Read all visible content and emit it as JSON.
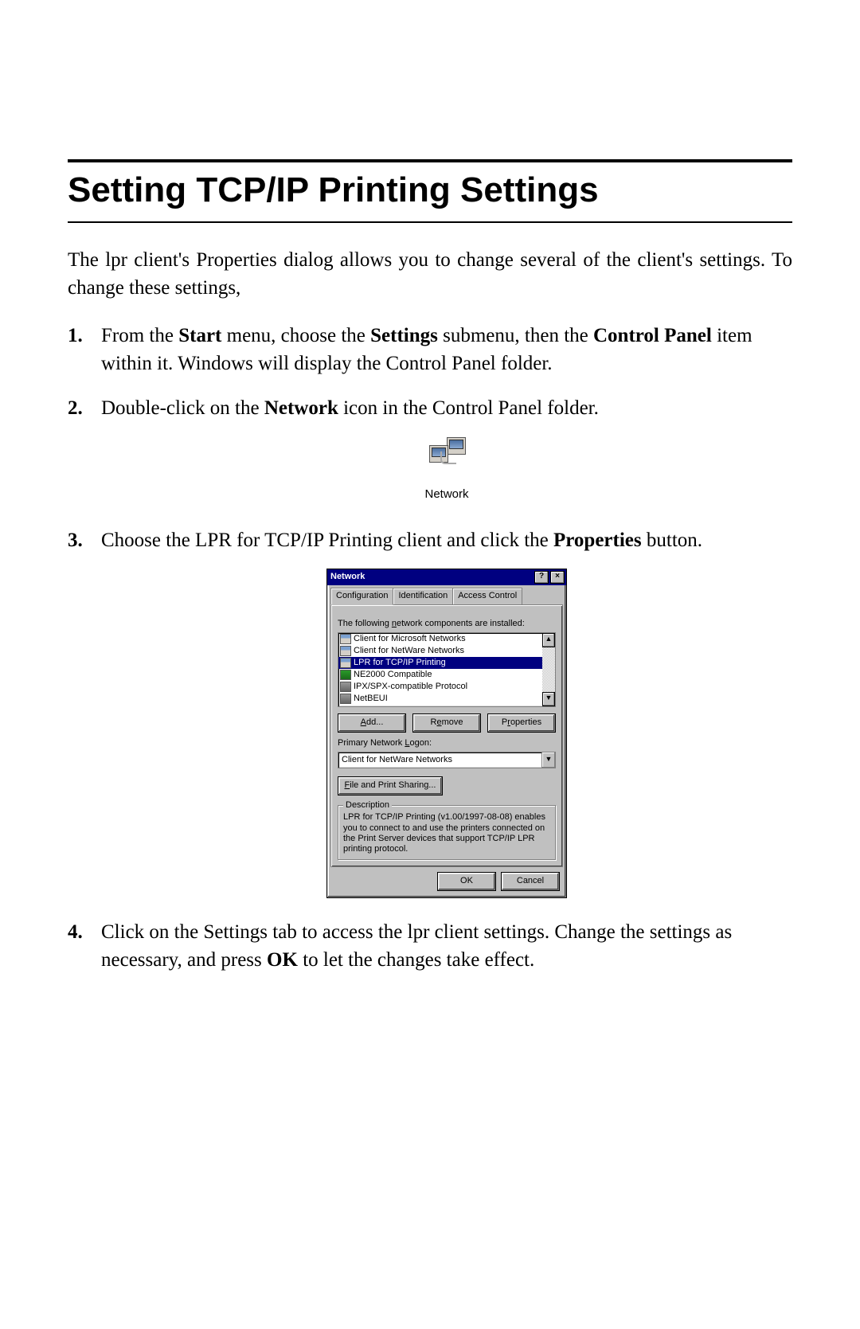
{
  "title": "Setting TCP/IP Printing Settings",
  "intro": "The lpr client's Properties dialog allows you to change several of the client's settings.    To change these settings,",
  "steps": {
    "s1": {
      "pre": "From the ",
      "b1": "Start",
      "mid1": " menu, choose the ",
      "b2": "Settings",
      "mid2": " submenu, then the ",
      "b3": "Control Panel",
      "mid3": " item within it.    Windows will display the Control Panel folder."
    },
    "s2": {
      "pre": "Double-click on the ",
      "b1": "Network",
      "post": " icon in the Control Panel folder."
    },
    "s3": {
      "pre": "Choose the LPR for TCP/IP Printing client and click the ",
      "b1": "Properties",
      "post": " button."
    },
    "s4": {
      "pre": "Click on the Settings tab to access the lpr client settings. Change the settings as necessary, and press ",
      "b1": "OK",
      "post": " to let the changes take effect."
    }
  },
  "icon_caption": "Network",
  "dialog": {
    "title": "Network",
    "help_btn": "?",
    "close_btn": "×",
    "tabs": [
      "Configuration",
      "Identification",
      "Access Control"
    ],
    "list_label": "The following network components are installed:",
    "items": [
      "Client for Microsoft Networks",
      "Client for NetWare Networks",
      "LPR for TCP/IP Printing",
      "NE2000 Compatible",
      "IPX/SPX-compatible Protocol",
      "NetBEUI"
    ],
    "add_btn": "Add...",
    "remove_btn": "Remove",
    "properties_btn": "Properties",
    "logon_label": "Primary Network Logon:",
    "logon_value": "Client for NetWare Networks",
    "fps_btn": "File and Print Sharing...",
    "desc_legend": "Description",
    "desc_text": "LPR for TCP/IP Printing (v1.00/1997-08-08) enables you to connect to and use the printers connected on the Print Server devices that support TCP/IP LPR printing protocol.",
    "ok_btn": "OK",
    "cancel_btn": "Cancel",
    "scroll_up": "▲",
    "scroll_down": "▼",
    "combo_arrow": "▼"
  }
}
